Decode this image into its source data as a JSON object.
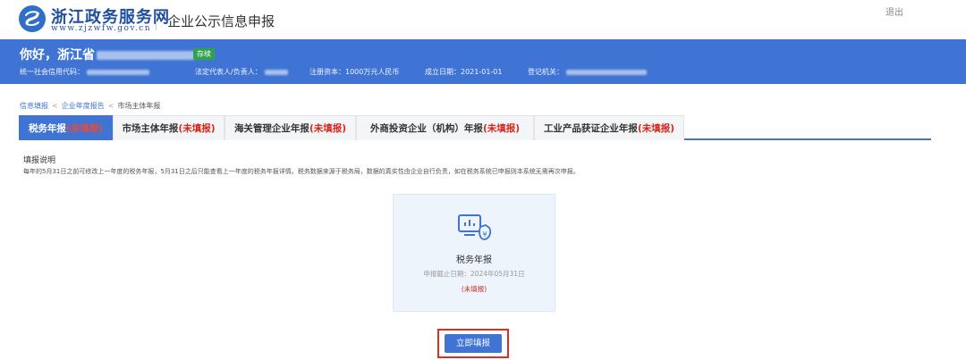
{
  "header": {
    "site_name": "浙江政务服务网",
    "site_url": "www.zjzwfw.gov.cn",
    "page_title": "企业公示信息申报",
    "logout": "退出"
  },
  "banner": {
    "greeting": "你好，浙江省",
    "badge": "存续",
    "credit_code_label": "统一社会信用代码：",
    "legal_rep_label": "法定代表人/负责人：",
    "capital": "注册资本：1000万元人民币",
    "established": "成立日期：2021-01-01",
    "authority_label": "登记机关："
  },
  "breadcrumb": {
    "items": [
      "信息填报",
      "企业年度报告",
      "市场主体年报"
    ]
  },
  "tabs": [
    {
      "label": "税务年报",
      "status": "(未填报)",
      "active": true
    },
    {
      "label": "市场主体年报",
      "status": "(未填报)",
      "active": false
    },
    {
      "label": "海关管理企业年报",
      "status": "(未填报)",
      "active": false
    },
    {
      "label": "外商投资企业（机构）年报",
      "status": "(未填报)",
      "active": false
    },
    {
      "label": "工业产品获证企业年报",
      "status": "(未填报)",
      "active": false
    }
  ],
  "instructions": {
    "title": "填报说明",
    "body": "每年的5月31日之前可修改上一年度的税务年报，5月31日之后只能查看上一年度的税务年报详情。税务数据来源于税务局，数据的真实性由企业自行负责，如在税务系统已申报则本系统无需再次申报。"
  },
  "card": {
    "icon": "tax-report-icon",
    "title": "税务年报",
    "deadline": "申报截止日期：2024年05月31日",
    "status": "(未填报)"
  },
  "action": {
    "label": "立即填报"
  },
  "colors": {
    "primary": "#3f74d4",
    "danger": "#d9261c",
    "badge": "#2fa34b"
  }
}
